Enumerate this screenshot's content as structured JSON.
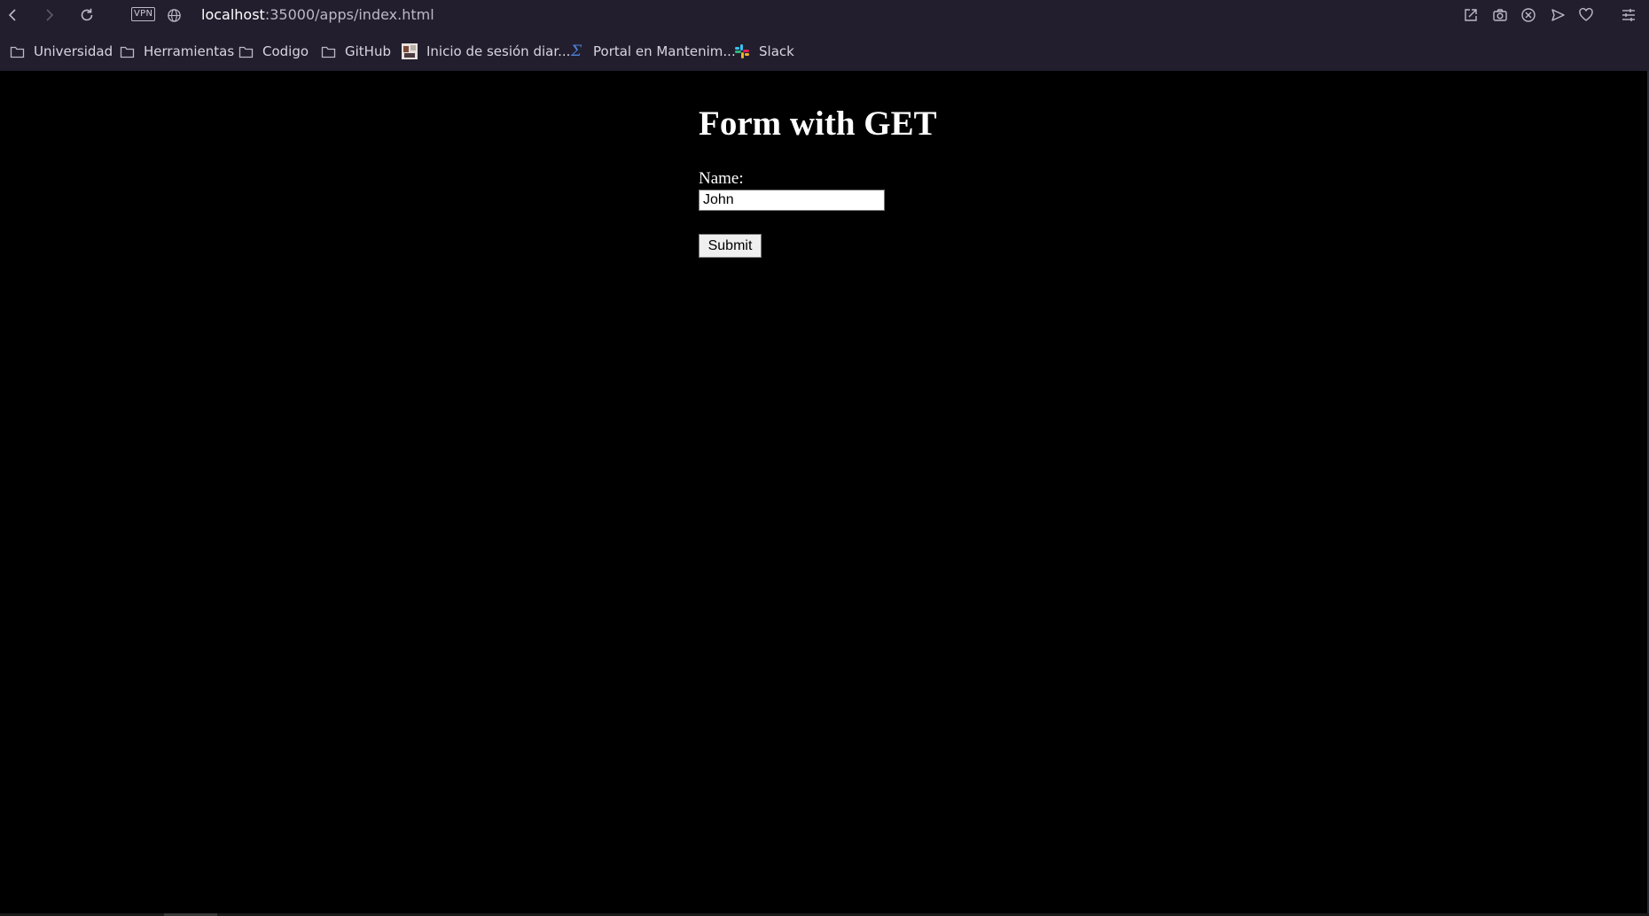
{
  "browser": {
    "vpn_label": "VPN",
    "url_host": "localhost",
    "url_rest": ":35000/apps/index.html"
  },
  "bookmarks": [
    {
      "label": "Universidad",
      "icon": "folder-icon"
    },
    {
      "label": "Herramientas",
      "icon": "folder-icon"
    },
    {
      "label": "Codigo",
      "icon": "folder-icon"
    },
    {
      "label": "GitHub",
      "icon": "folder-icon"
    },
    {
      "label": "Inicio de sesión diar...",
      "icon": "site-favicon"
    },
    {
      "label": "Portal en Mantenim...",
      "icon": "sigma-icon"
    },
    {
      "label": "Slack",
      "icon": "slack-icon"
    }
  ],
  "page": {
    "title": "Form with GET",
    "form": {
      "name_label": "Name:",
      "name_value": "John",
      "submit_label": "Submit"
    }
  },
  "colors": {
    "chrome_bg": "#221e2e",
    "page_bg": "#000000",
    "text": "#ffffff"
  }
}
